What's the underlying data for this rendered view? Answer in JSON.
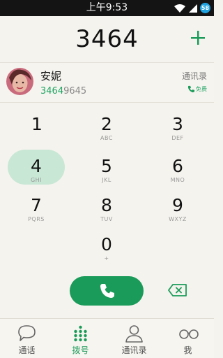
{
  "status_bar": {
    "time": "上午9:53",
    "battery": "58"
  },
  "dialer": {
    "number": "3464"
  },
  "contact": {
    "name": "安妮",
    "number_match": "3464",
    "number_rest": "9645",
    "contacts_link": "通讯录",
    "free_label": "免费"
  },
  "keypad": {
    "keys": [
      {
        "digit": "1",
        "letters": ""
      },
      {
        "digit": "2",
        "letters": "ABC"
      },
      {
        "digit": "3",
        "letters": "DEF"
      },
      {
        "digit": "4",
        "letters": "GHI"
      },
      {
        "digit": "5",
        "letters": "JKL"
      },
      {
        "digit": "6",
        "letters": "MNO"
      },
      {
        "digit": "7",
        "letters": "PQRS"
      },
      {
        "digit": "8",
        "letters": "TUV"
      },
      {
        "digit": "9",
        "letters": "WXYZ"
      },
      {
        "digit": "0",
        "letters": "+"
      }
    ]
  },
  "nav": {
    "items": [
      {
        "label": "通话",
        "icon": "chat-bubble-icon"
      },
      {
        "label": "拨号",
        "icon": "dialpad-icon"
      },
      {
        "label": "通讯录",
        "icon": "person-icon"
      },
      {
        "label": "我",
        "icon": "glasses-icon"
      }
    ]
  },
  "colors": {
    "accent": "#1a9b59",
    "active_key": "#c8e7d5",
    "battery": "#1fa3e0"
  }
}
